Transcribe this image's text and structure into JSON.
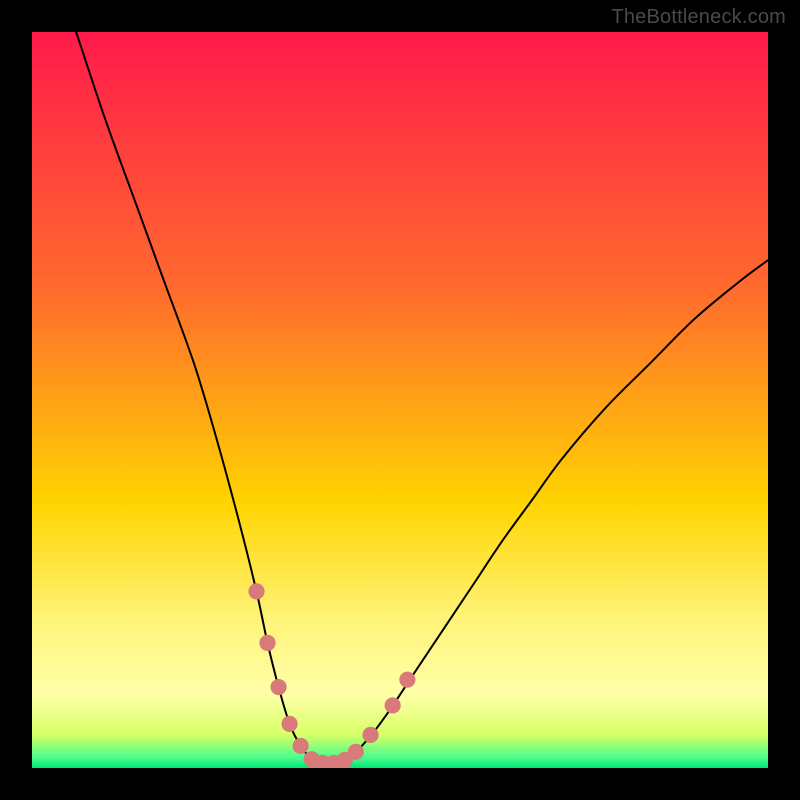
{
  "watermark": "TheBottleneck.com",
  "chart_data": {
    "type": "line",
    "title": "",
    "xlabel": "",
    "ylabel": "",
    "xlim": [
      0,
      100
    ],
    "ylim": [
      0,
      100
    ],
    "grid": false,
    "legend": false,
    "background_gradient": {
      "stops": [
        {
          "offset": 0.0,
          "color": "#ff1a4b"
        },
        {
          "offset": 0.35,
          "color": "#ff6b2d"
        },
        {
          "offset": 0.64,
          "color": "#ffd400"
        },
        {
          "offset": 0.8,
          "color": "#fff47a"
        },
        {
          "offset": 0.9,
          "color": "#ffffa8"
        },
        {
          "offset": 0.955,
          "color": "#d7ff66"
        },
        {
          "offset": 0.985,
          "color": "#4eff8d"
        },
        {
          "offset": 1.0,
          "color": "#00e676"
        }
      ]
    },
    "series": [
      {
        "name": "bottleneck-curve",
        "color": "#000000",
        "x": [
          6,
          10,
          14,
          18,
          22,
          25,
          28,
          30.5,
          32,
          33.5,
          35,
          36.5,
          38,
          39,
          40,
          41.5,
          43,
          45,
          48,
          52,
          56,
          60,
          64,
          68,
          72,
          78,
          84,
          90,
          96,
          100
        ],
        "values": [
          100,
          88,
          77,
          66,
          55,
          45,
          34,
          24,
          17,
          11,
          6,
          3,
          1.2,
          0.7,
          0.7,
          0.8,
          1.5,
          3.2,
          7,
          13,
          19,
          25,
          31,
          36.5,
          42,
          49,
          55,
          61,
          66,
          69
        ]
      }
    ],
    "highlight_markers": {
      "color": "#d97a7a",
      "radius_frac": 0.011,
      "points": [
        {
          "x": 30.5,
          "y": 24
        },
        {
          "x": 32,
          "y": 17
        },
        {
          "x": 33.5,
          "y": 11
        },
        {
          "x": 35,
          "y": 6
        },
        {
          "x": 36.5,
          "y": 3
        },
        {
          "x": 38,
          "y": 1.2
        },
        {
          "x": 39.5,
          "y": 0.7
        },
        {
          "x": 41,
          "y": 0.7
        },
        {
          "x": 42.5,
          "y": 1.1
        },
        {
          "x": 44,
          "y": 2.2
        },
        {
          "x": 46,
          "y": 4.5
        },
        {
          "x": 49,
          "y": 8.5
        },
        {
          "x": 51,
          "y": 12
        }
      ]
    }
  }
}
